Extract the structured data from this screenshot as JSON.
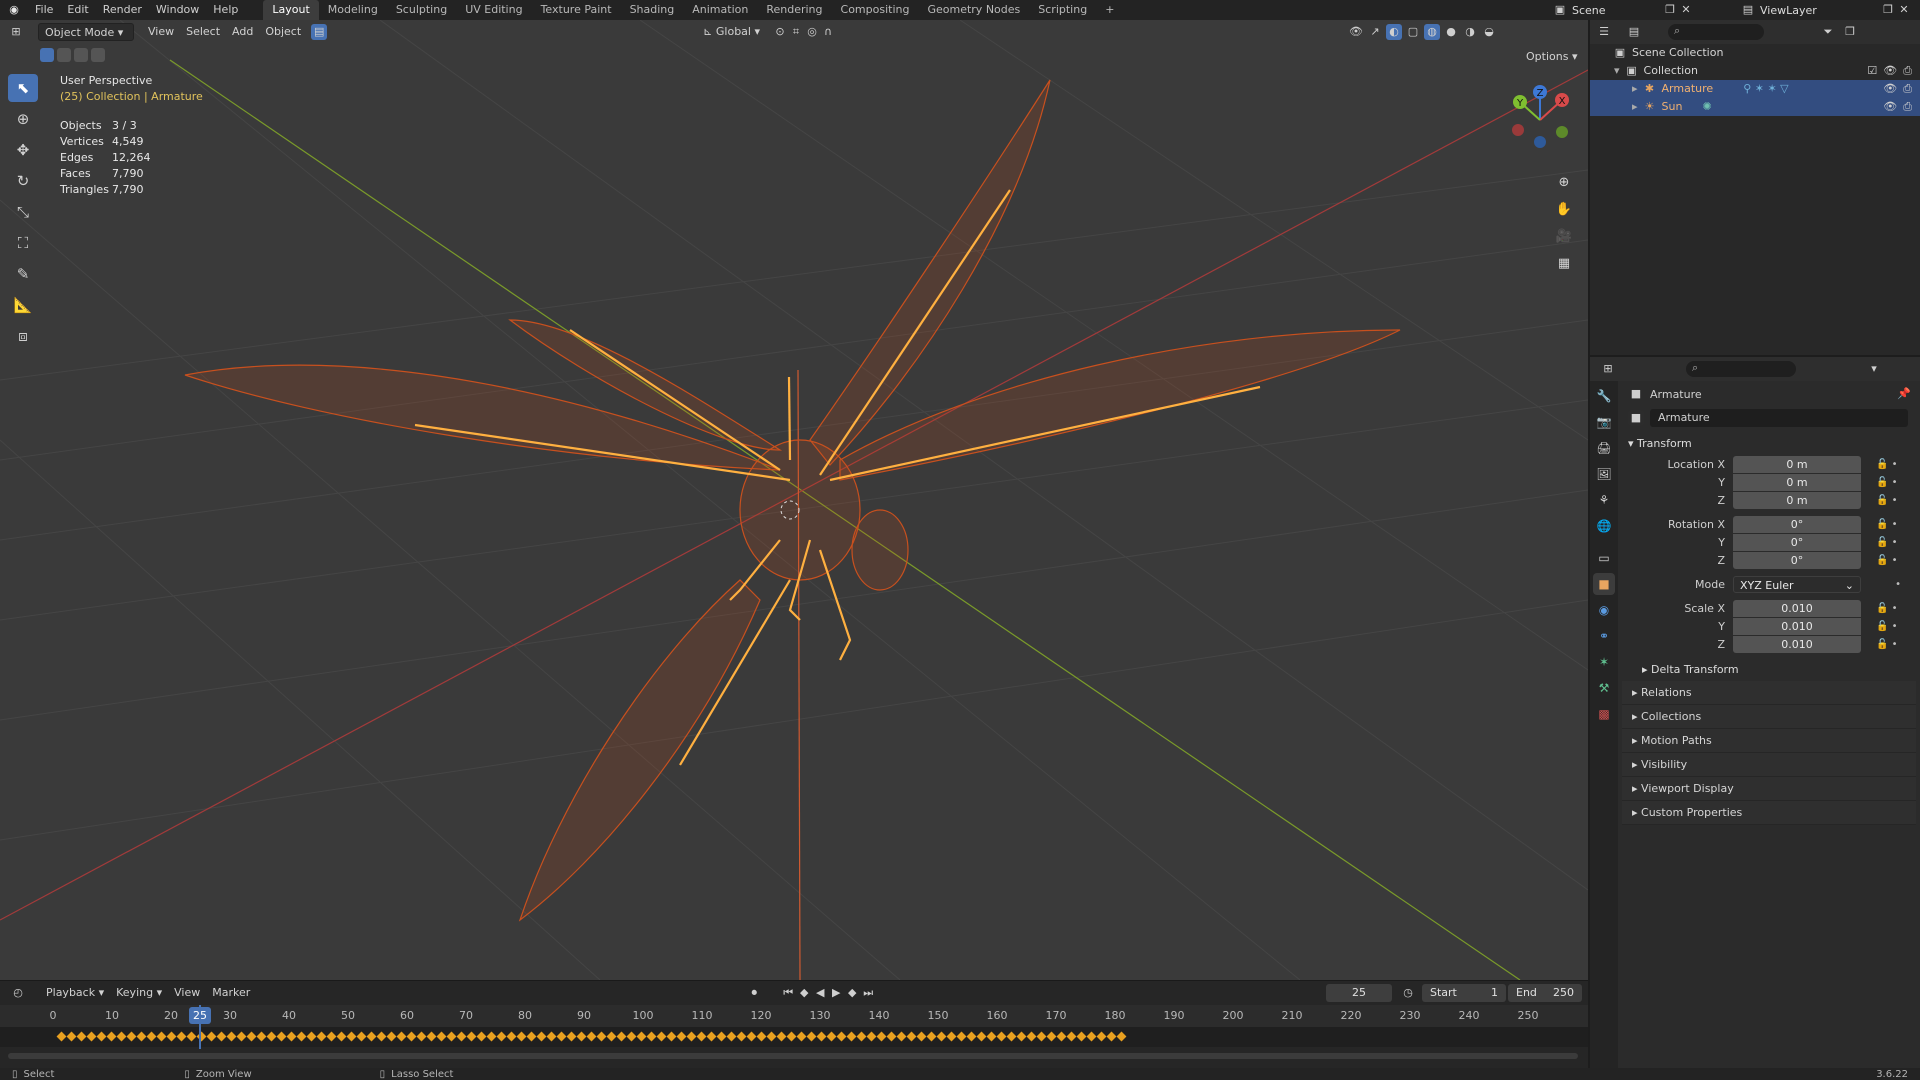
{
  "topbar": {
    "menus": [
      "File",
      "Edit",
      "Render",
      "Window",
      "Help"
    ],
    "workspaces": [
      "Layout",
      "Modeling",
      "Sculpting",
      "UV Editing",
      "Texture Paint",
      "Shading",
      "Animation",
      "Rendering",
      "Compositing",
      "Geometry Nodes",
      "Scripting"
    ],
    "active_workspace": "Layout",
    "scene": "Scene",
    "view_layer": "ViewLayer"
  },
  "viewport": {
    "mode": "Object Mode",
    "menus": [
      "View",
      "Select",
      "Add",
      "Object"
    ],
    "transform_orientation": "Global",
    "options_label": "Options",
    "perspective_label": "User Perspective",
    "collection_label": "(25) Collection | Armature",
    "stats": [
      {
        "key": "Objects",
        "value": "3 / 3"
      },
      {
        "key": "Vertices",
        "value": "4,549"
      },
      {
        "key": "Edges",
        "value": "12,264"
      },
      {
        "key": "Faces",
        "value": "7,790"
      },
      {
        "key": "Triangles",
        "value": "7,790"
      }
    ],
    "axis_labels": {
      "x": "X",
      "y": "Y",
      "z": "Z"
    }
  },
  "timeline": {
    "menus": [
      "Playback",
      "Keying",
      "View",
      "Marker"
    ],
    "current_frame": "25",
    "start_label": "Start",
    "start": "1",
    "end_label": "End",
    "end": "250",
    "ticks": [
      "0",
      "10",
      "20",
      "30",
      "40",
      "50",
      "60",
      "70",
      "80",
      "90",
      "100",
      "110",
      "120",
      "130",
      "140",
      "150",
      "160",
      "170",
      "180",
      "190",
      "200",
      "210",
      "220",
      "230",
      "240",
      "250"
    ]
  },
  "statusbar": {
    "select": "Select",
    "zoom": "Zoom View",
    "lasso": "Lasso Select",
    "version": "3.6.22"
  },
  "outliner": {
    "root": "Scene Collection",
    "collection": "Collection",
    "items": [
      {
        "name": "Armature",
        "color": "#e8a560"
      },
      {
        "name": "Sun",
        "color": "#e8a560"
      }
    ]
  },
  "properties": {
    "object_name": "Armature",
    "data_name": "Armature",
    "transform_label": "Transform",
    "location_label": "Location X",
    "location": [
      "0 m",
      "0 m",
      "0 m"
    ],
    "rotation_label": "Rotation X",
    "rotation": [
      "0°",
      "0°",
      "0°"
    ],
    "mode_label": "Mode",
    "mode": "XYZ Euler",
    "scale_label": "Scale X",
    "scale": [
      "0.010",
      "0.010",
      "0.010"
    ],
    "axis_y": "Y",
    "axis_z": "Z",
    "delta_transform": "Delta Transform",
    "panels": [
      "Relations",
      "Collections",
      "Motion Paths",
      "Visibility",
      "Viewport Display",
      "Custom Properties"
    ]
  },
  "colors": {
    "accent": "#4772b3",
    "selection": "#ff8a3d",
    "bone": "#ffb040"
  }
}
